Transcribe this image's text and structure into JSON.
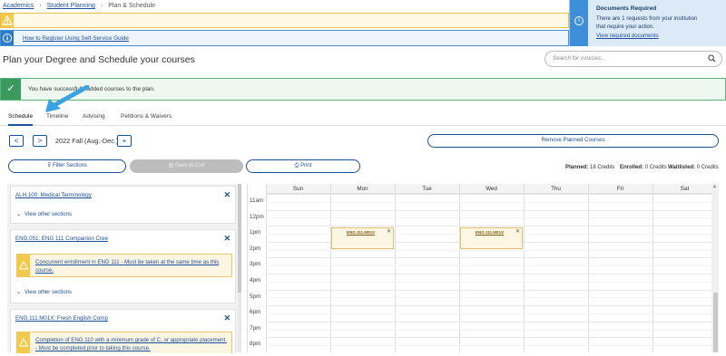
{
  "breadcrumb": [
    "Academics",
    "Student Planning",
    "Plan & Schedule"
  ],
  "info_bar": {
    "link": "How to Register Using Self-Service Guide",
    "icon": "info-icon"
  },
  "docs_popup": {
    "title": "Documents Required",
    "message": "There are 1 requests from your institution that require your action.",
    "link": "View required documents"
  },
  "page_title": "Plan your Degree and Schedule your courses",
  "search": {
    "placeholder": "Search for courses..."
  },
  "success": {
    "message": "You have successfully added courses to the plan."
  },
  "tabs": [
    "Schedule",
    "Timeline",
    "Advising",
    "Petitions & Waivers"
  ],
  "term": {
    "label": "2022 Fall (Aug.-Dec.)",
    "prev": "<",
    "next": ">",
    "add": "+"
  },
  "buttons": {
    "remove_planned": "Remove Planned Courses",
    "filter_sections": "Filter Sections",
    "save_ical": "Save to iCal",
    "print": "Print"
  },
  "credits": {
    "planned_label": "Planned:",
    "planned_value": "18 Credits",
    "enrolled_label": "Enrolled:",
    "enrolled_value": "0 Credits",
    "waitlisted_label": "Waitlisted:",
    "waitlisted_value": "0 Credits"
  },
  "courses": [
    {
      "title": "ALH.100: Medical Terminology",
      "view_other": "View other sections"
    },
    {
      "title": "ENG.051: ENG 111 Companion Cree",
      "alert": "Concurrent enrollment in ENG 111 - Must be taken at the same time as this course.",
      "view_other": "View other sections"
    },
    {
      "title": "ENG.111.M01X: Fresh English Comp",
      "alert": "Completion of ENG.110 with a minimum grade of C, or appropriate placement. - Must be completed prior to taking this course."
    }
  ],
  "calendar": {
    "days": [
      "Sun",
      "Mon",
      "Tue",
      "Wed",
      "Thu",
      "Fri",
      "Sat"
    ],
    "hours": [
      "11am",
      "12pm",
      "1pm",
      "2pm",
      "3pm",
      "4pm",
      "5pm",
      "6pm",
      "7pm",
      "8pm"
    ],
    "events": [
      {
        "label": "ENG.111.M01X",
        "day": "Mon",
        "start": "1pm"
      },
      {
        "label": "ENG.111.M01X",
        "day": "Wed",
        "start": "1pm"
      }
    ]
  },
  "colors": {
    "brand": "#1d4e9e",
    "success": "#3c9a5f",
    "warning": "#f2c94c",
    "info": "#2b7bc7",
    "annotation_arrow": "#3aa3e3"
  }
}
